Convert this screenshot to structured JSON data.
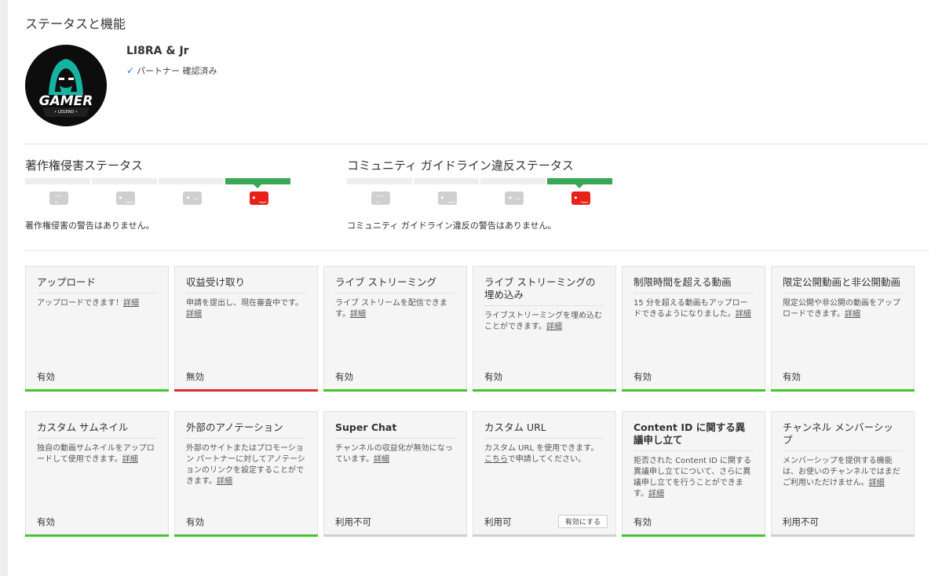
{
  "page": {
    "title": "ステータスと機能"
  },
  "channel": {
    "name": "LI8RA & Jr",
    "verified": "パートナー 確認済み",
    "avatar_text": "GAMER",
    "avatar_sub": "• LEGEND •"
  },
  "copyright": {
    "title": "著作権侵害ステータス",
    "message": "著作権侵害の警告はありません。",
    "active_level": 4
  },
  "community": {
    "title": "コミュニティ ガイドライン違反ステータス",
    "message": "コミュニティ ガイドライン違反の警告はありません。",
    "active_level": 4
  },
  "status_colors": {
    "enabled": "#43c62b",
    "disabled": "#e02b2b",
    "unavailable": "#cfcfcf",
    "strike_active": "#e62117",
    "strike_bar": "#3aa757"
  },
  "features": [
    {
      "title": "アップロード",
      "desc": "アップロードできます！",
      "link": "詳細",
      "link_after": "",
      "status": "有効",
      "state": "enabled"
    },
    {
      "title": "収益受け取り",
      "desc": "申請を提出し、現在審査中です。",
      "link": "詳細",
      "link_after": "",
      "status": "無効",
      "state": "disabled"
    },
    {
      "title": "ライブ ストリーミング",
      "desc": "ライブ ストリームを配信できます。",
      "link": "詳細",
      "link_after": "",
      "status": "有効",
      "state": "enabled"
    },
    {
      "title": "ライブ ストリーミングの埋め込み",
      "desc": "ライブストリーミングを埋め込むことができます。",
      "link": "詳細",
      "link_after": "",
      "status": "有効",
      "state": "enabled"
    },
    {
      "title": "制限時間を超える動画",
      "desc": "15 分を超える動画もアップロードできるようになりました。",
      "link": "詳細",
      "link_after": "",
      "status": "有効",
      "state": "enabled"
    },
    {
      "title": "限定公開動画と非公開動画",
      "desc": "限定公開や非公開の動画をアップロードできます。",
      "link": "詳細",
      "link_after": "",
      "status": "有効",
      "state": "enabled"
    },
    {
      "title": "カスタム サムネイル",
      "desc": "独自の動画サムネイルをアップロードして使用できます。",
      "link": "詳細",
      "link_after": "",
      "status": "有効",
      "state": "enabled"
    },
    {
      "title": "外部のアノテーション",
      "desc": "外部のサイトまたはプロモーション パートナーに対してアノテーションのリンクを設定することができます。",
      "link": "詳細",
      "link_after": "",
      "status": "有効",
      "state": "enabled"
    },
    {
      "title": "Super Chat",
      "desc": "チャンネルの収益化が無効になっています。",
      "link": "詳細",
      "link_after": "",
      "status": "利用不可",
      "state": "unavailable"
    },
    {
      "title": "カスタム URL",
      "desc": "カスタム URL を使用できます。",
      "link": "こちら",
      "link_after": "で申請してください。",
      "status": "利用可",
      "state": "unavailable",
      "button": "有効にする"
    },
    {
      "title": "Content ID に関する異議申し立て",
      "desc": "拒否された Content ID に関する異議申し立てについて、さらに異議申し立てを行うことができます。",
      "link": "詳細",
      "link_after": "",
      "status": "有効",
      "state": "enabled"
    },
    {
      "title": "チャンネル メンバーシップ",
      "desc": "メンバーシップを提供する機能は、お使いのチャンネルではまだご利用いただけません。",
      "link": "詳細",
      "link_after": "",
      "status": "利用不可",
      "state": "unavailable"
    }
  ]
}
